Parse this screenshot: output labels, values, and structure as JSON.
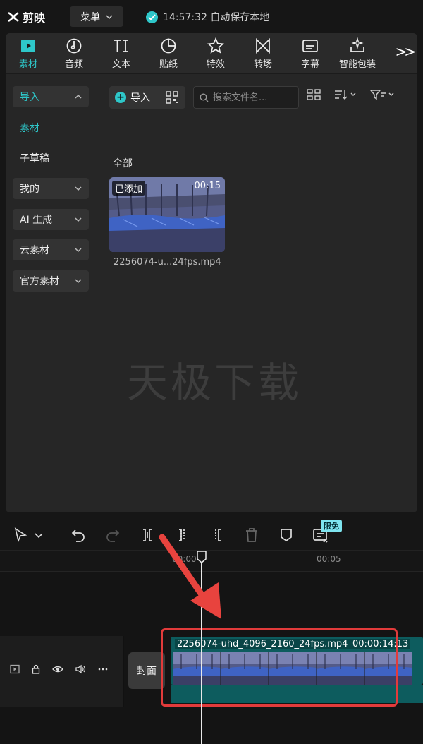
{
  "app": {
    "logo_text": "剪映",
    "menu_label": "菜单",
    "save_status": "14:57:32 自动保存本地"
  },
  "toolbar": {
    "tabs": [
      {
        "label": "素材",
        "icon": "media-icon",
        "active": true
      },
      {
        "label": "音频",
        "icon": "audio-icon"
      },
      {
        "label": "文本",
        "icon": "text-icon"
      },
      {
        "label": "贴纸",
        "icon": "sticker-icon"
      },
      {
        "label": "特效",
        "icon": "effects-icon"
      },
      {
        "label": "转场",
        "icon": "transition-icon"
      },
      {
        "label": "字幕",
        "icon": "subtitle-icon"
      },
      {
        "label": "智能包装",
        "icon": "smart-pack-icon"
      }
    ],
    "more_label": ">>"
  },
  "sidebar": {
    "items": [
      {
        "label": "导入"
      },
      {
        "label": "素材"
      },
      {
        "label": "子草稿"
      },
      {
        "label": "我的"
      },
      {
        "label": "AI 生成"
      },
      {
        "label": "云素材"
      },
      {
        "label": "官方素材"
      }
    ]
  },
  "content": {
    "import_label": "导入",
    "search_placeholder": "搜索文件名...",
    "section_title": "全部",
    "media": {
      "added_badge": "已添加",
      "duration": "00:15",
      "filename": "2256074-u...24fps.mp4"
    },
    "watermark": "天极下载"
  },
  "timeline": {
    "free_badge": "限免",
    "ruler": [
      "00:00",
      "00:05"
    ],
    "cover_label": "封面",
    "clip_name": "2256074-uhd_4096_2160_24fps.mp4",
    "clip_duration": "00:00:14:13"
  },
  "colors": {
    "accent": "#2ec7c9",
    "clip": "#0d5c5e",
    "highlight": "#e23b3b"
  }
}
